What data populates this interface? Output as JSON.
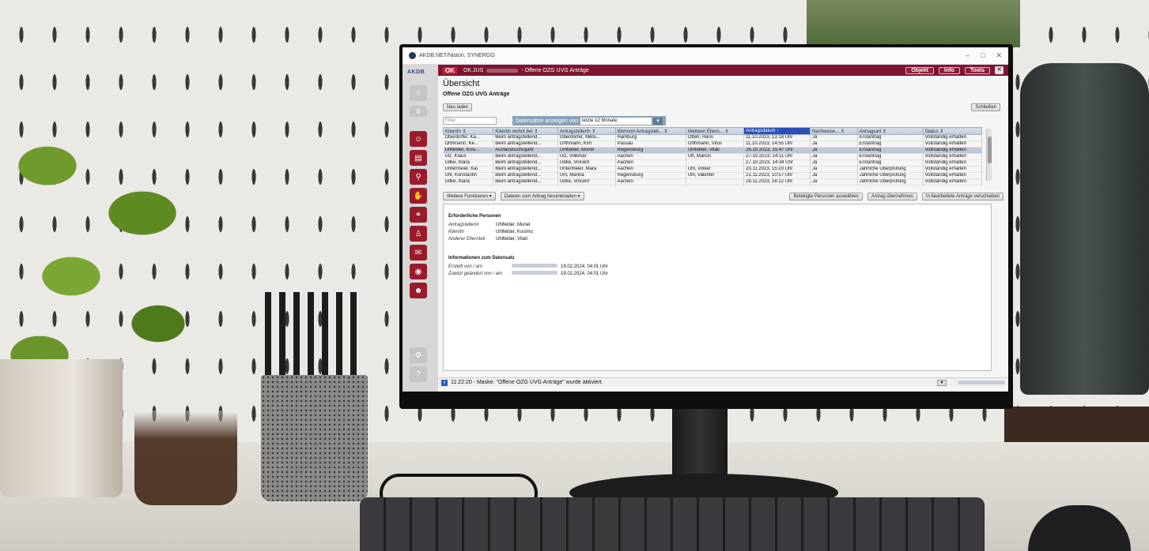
{
  "window": {
    "title": "AKDB.NET/Nistori, SYNERGO",
    "controls": [
      "–",
      "□",
      "✕"
    ]
  },
  "left_bar": {
    "logo": "AKDB",
    "icons": [
      "star-icon",
      "list-icon",
      "person-add-icon",
      "document-icon",
      "person-search-icon",
      "hand-icon",
      "family-icon",
      "people-icon",
      "mail-icon",
      "target-icon",
      "person-id-icon",
      "settings-icon",
      "help-icon"
    ]
  },
  "header": {
    "badge": "OK",
    "title_prefix": "OK.JUS",
    "title_suffix": "- Offene OZG UVG Anträge",
    "buttons": [
      "Objekt",
      "Info",
      "Tools"
    ],
    "close": "✕"
  },
  "main": {
    "title": "Übersicht",
    "subtitle": "Offene OZG UVG Anträge",
    "new_load_button": "Neu laden",
    "close_button": "Schließen",
    "filter_placeholder": "Filter",
    "range_label": "Datensätze anzeigen von",
    "range_value": "letzte 12 Monate"
  },
  "table": {
    "columns": [
      "KlientIn ⇕",
      "KlientIn wohnt bei ⇕",
      "AntragstellerIn ⇕",
      "Wohnort Antragstell... ⇕",
      "Weiterer Eltern... ⇕",
      "Antragsdatum ↑",
      "Nachweise... ⇕",
      "Antragsart ⇕",
      "Status ⇕"
    ],
    "active_column": 5,
    "selected_row": 2,
    "rows": [
      [
        "Oberdorfer, Ka...",
        "Beim antragstellend...",
        "Oberdorfer, Melis...",
        "Hamburg",
        "Otten, Hans",
        "11.10.2023, 13:18 Uhr",
        "Ja",
        "Erstantrag",
        "Vollständig erhalten"
      ],
      [
        "Orthmann, Ke...",
        "Beim antragstellend...",
        "Orthmann, Kim",
        "Passau",
        "Orthmann, Vitus",
        "11.10.2023, 14:55 Uhr",
        "Ja",
        "Erstantrag",
        "Vollständig erhalten"
      ],
      [
        "Uhlfelder, Kosi...",
        "Auslandsschuljahr",
        "Uhlfelder, Muriel",
        "Regensburg",
        "Uhlfelder, Vitali",
        "26.10.2023, 15:47 Uhr",
        "Ja",
        "Erstantrag",
        "Vollständig erhalten"
      ],
      [
        "Ulz, Klaus",
        "Beim antragstellend...",
        "Ulz, Volkmar",
        "Aachen",
        "Uff, Marion",
        "27.10.2023, 14:11 Uhr",
        "Ja",
        "Erstantrag",
        "Vollständig erhalten"
      ],
      [
        "Udke, Klara",
        "Beim antragstellend...",
        "Udke, Vincent",
        "Aachen",
        "",
        "27.10.2023, 14:34 Uhr",
        "Ja",
        "Erstantrag",
        "Vollständig erhalten"
      ],
      [
        "Untermeier, Kai",
        "Beim antragstellend...",
        "Untermeier, Mara",
        "Aachen",
        "Uhl, Volker",
        "20.11.2023, 15:20 Uhr",
        "Ja",
        "Jährliche Überprüfung",
        "Vollständig erhalten"
      ],
      [
        "Uhl, Konstantin",
        "Beim antragstellend...",
        "Uhl, Marina",
        "Regensburg",
        "Uhl, Valentin",
        "21.11.2023, 10:57 Uhr",
        "Ja",
        "Jährliche Überprüfung",
        "Vollständig erhalten"
      ],
      [
        "Udke, Klara",
        "Beim antragstellend...",
        "Udke, Vincent",
        "Aachen",
        "",
        "28.11.2023, 16:12 Uhr",
        "Ja",
        "Jährliche Überprüfung",
        "Vollständig erhalten"
      ]
    ]
  },
  "actions": {
    "more_functions": "Weitere Funktionen",
    "download_files": "Dateien zum Antrag herunterladen",
    "select_persons": "Beteiligte Personen auswählen",
    "accept_request": "Antrag übernehmen",
    "move_to_processed": "In bearbeitete Anträge verschieben"
  },
  "details": {
    "persons_heading": "Erforderliche Personen",
    "persons": [
      {
        "label": "AntragstellerIn",
        "value": "Uhlfelder, Muriel"
      },
      {
        "label": "KlientIn",
        "value": "Uhlfelder, Kosimo"
      },
      {
        "label": "Anderer Elternteil",
        "value": "Uhlfelder, Vitali"
      }
    ],
    "record_heading": "Informationen zum Datensatz",
    "record": [
      {
        "label": "Erstellt von / am",
        "value": "19.02.2024, 04:01 Uhr"
      },
      {
        "label": "Zuletzt geändert von / am",
        "value": "19.02.2024, 04:01 Uhr"
      }
    ]
  },
  "status_bar": {
    "icon": "i",
    "message": "11:22:20 - Maske: \"Offene OZG UVG Anträge\" wurde aktiviert."
  },
  "colors": {
    "accent": "#7d1530",
    "badge": "#c81d3a",
    "active_header": "#2a4fb8",
    "selected_row": "#bfc8d4"
  }
}
